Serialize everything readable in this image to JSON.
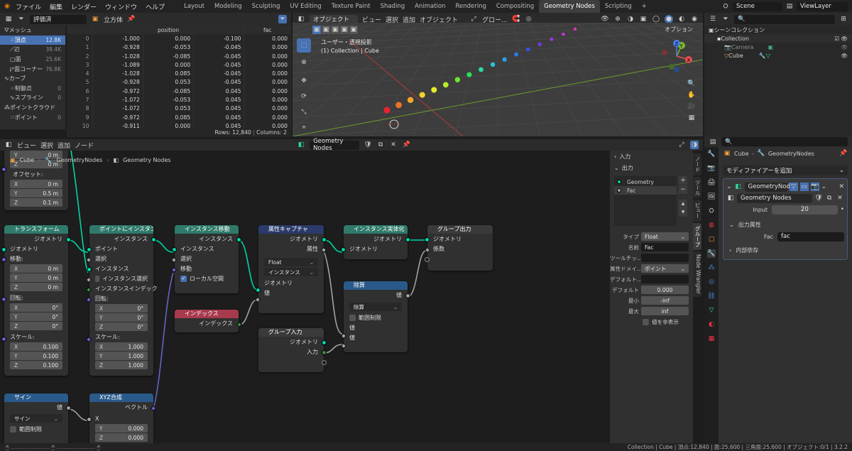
{
  "topbar": {
    "menus": [
      "ファイル",
      "編集",
      "レンダー",
      "ウィンドウ",
      "ヘルプ"
    ],
    "workspaces": [
      "Layout",
      "Modeling",
      "Sculpting",
      "UV Editing",
      "Texture Paint",
      "Shading",
      "Animation",
      "Rendering",
      "Compositing",
      "Geometry Nodes",
      "Scripting"
    ],
    "active_workspace": "Geometry Nodes",
    "scene": "Scene",
    "view_layer": "ViewLayer"
  },
  "spreadsheet": {
    "header_mode": "評価済",
    "object": "立方体",
    "left_items": [
      {
        "label": "メッシュ",
        "count": ""
      },
      {
        "label": "頂点",
        "count": "12.8K"
      },
      {
        "label": "辺",
        "count": "38.4K"
      },
      {
        "label": "面",
        "count": "25.6K"
      },
      {
        "label": "面コーナー",
        "count": "76.8K"
      },
      {
        "label": "カーブ",
        "count": ""
      },
      {
        "label": "制御点",
        "count": "0"
      },
      {
        "label": "スプライン",
        "count": "0"
      },
      {
        "label": "ポイントクラウド",
        "count": ""
      },
      {
        "label": "ポイント",
        "count": "0"
      }
    ],
    "columns": [
      "position",
      "fac"
    ],
    "rows": [
      [
        "0",
        "-1.000",
        "0.000",
        "-0.100",
        "0.000"
      ],
      [
        "1",
        "-0.928",
        "-0.053",
        "-0.045",
        "0.000"
      ],
      [
        "2",
        "-1.028",
        "-0.085",
        "-0.045",
        "0.000"
      ],
      [
        "3",
        "-1.089",
        "0.000",
        "-0.045",
        "0.000"
      ],
      [
        "4",
        "-1.028",
        "0.085",
        "-0.045",
        "0.000"
      ],
      [
        "5",
        "-0.928",
        "0.053",
        "-0.045",
        "0.000"
      ],
      [
        "6",
        "-0.972",
        "-0.085",
        "0.045",
        "0.000"
      ],
      [
        "7",
        "-1.072",
        "-0.053",
        "0.045",
        "0.000"
      ],
      [
        "8",
        "-1.072",
        "0.053",
        "0.045",
        "0.000"
      ],
      [
        "9",
        "-0.972",
        "0.085",
        "0.045",
        "0.000"
      ],
      [
        "10",
        "-0.911",
        "0.000",
        "0.045",
        "0.000"
      ]
    ],
    "footer_rows": "Rows: 12,840",
    "footer_cols": "Columns: 2"
  },
  "viewport": {
    "mode": "オブジェクト",
    "menus": [
      "ビュー",
      "選択",
      "追加",
      "オブジェクト"
    ],
    "global": "グロー...",
    "overlay1": "ユーザー・透視投影",
    "overlay2": "(1) Collection | Cube",
    "options": "オプション",
    "gizmo_x": "X",
    "gizmo_y": "Y",
    "gizmo_z": "Z"
  },
  "outliner": {
    "title": "シーンコレクション",
    "collection": "Collection",
    "camera": "Camera",
    "cube": "Cube"
  },
  "node_editor": {
    "menus": [
      "ビュー",
      "選択",
      "追加",
      "ノード"
    ],
    "tree_name": "Geometry Nodes",
    "breadcrumb": [
      "Cube",
      "GeometryNodes",
      "Geometry Nodes"
    ],
    "partial_top": {
      "y": "0 m",
      "z": "0 m",
      "offset_label": "オフセット:",
      "x_val": "0 m",
      "y_val": "0.5 m",
      "z_val": "0.1 m"
    },
    "transform": {
      "title": "トランスフォーム",
      "geometry_out": "ジオメトリ",
      "geometry_in": "ジオメトリ",
      "translation": "移動:",
      "rotation": "回転:",
      "scale": "スケール:",
      "t": [
        "0 m",
        "0 m",
        "0 m"
      ],
      "r": [
        "0°",
        "0°",
        "0°"
      ],
      "s": [
        "0.100",
        "0.100",
        "0.100"
      ]
    },
    "instance_on_points": {
      "title": "ポイントにインスタン...",
      "out": "インスタンス",
      "points": "ポイント",
      "selection": "選択",
      "instance": "インスタンス",
      "pick": "インスタンス選択",
      "index": "インスタンスインデック",
      "rotation": "回転:",
      "scale": "スケール:",
      "r": [
        "0°",
        "0°",
        "0°"
      ],
      "s": [
        "1.000",
        "1.000",
        "1.000"
      ]
    },
    "translate_instances": {
      "title": "インスタンス移動",
      "out": "インスタンス",
      "in": "インスタンス",
      "selection": "選択",
      "translation": "移動",
      "local": "ローカル空間"
    },
    "index": {
      "title": "インデックス",
      "out": "インデックス"
    },
    "capture": {
      "title": "属性キャプチャ",
      "geo_out": "ジオメトリ",
      "attr_out": "属性",
      "type": "Float",
      "domain": "インスタンス",
      "geo_in": "ジオメトリ",
      "value": "値"
    },
    "realize": {
      "title": "インスタンス実体化",
      "out": "ジオメトリ",
      "in": "ジオメトリ"
    },
    "group_output": {
      "title": "グループ出力",
      "geo": "ジオメトリ",
      "fac": "係数"
    },
    "divide": {
      "title": "除算",
      "out": "値",
      "op": "除算",
      "clamp": "範囲制限",
      "a": "値",
      "b": "値"
    },
    "group_input": {
      "title": "グループ入力",
      "geo": "ジオメトリ",
      "input": "入力"
    },
    "sine": {
      "title": "サイン",
      "out": "値",
      "op": "サイン",
      "clamp": "範囲制限"
    },
    "combine_xyz": {
      "title": "XYZ合成",
      "out": "ベクトル",
      "x": "X",
      "y_label": "Y",
      "y_val": "0.000",
      "z_label": "Z",
      "z_val": "0.000"
    },
    "labels_x": "X",
    "labels_y": "Y",
    "labels_z": "Z"
  },
  "group_panel": {
    "inputs_label": "入力",
    "outputs_label": "出力",
    "items": [
      "Geometry",
      "Fac"
    ],
    "type_label": "タイプ",
    "type_val": "Float",
    "name_label": "名前",
    "name_val": "Fac",
    "tooltip_label": "ツールチッ...",
    "domain_label": "属性ドメイ...",
    "domain_val": "ポイント",
    "default_label": "デフォルト...",
    "default2_label": "デフォルト",
    "default2_val": "0.000",
    "min_label": "最小",
    "min_val": "-inf",
    "max_label": "最大",
    "max_val": "inf",
    "hide_value": "値を非表示"
  },
  "sidebar_tabs": [
    "ノード",
    "ツール",
    "ビュー",
    "グループ",
    "Node Wrangler"
  ],
  "properties": {
    "breadcrumb": [
      "Cube",
      "GeometryNodes"
    ],
    "add_modifier": "モディファイアーを追加",
    "modifier_name": "GeometryNod...",
    "tree": "Geometry Nodes",
    "input_label": "Input",
    "input_val": "20",
    "output_attr": "出力属性",
    "fac_label": "Fac",
    "fac_val": "fac",
    "internal": "内部依存"
  },
  "status": "Collection | Cube | 頂点:12,840 | 面:25,600 | 三角面:25,600 | オブジェクト:0/1 | 3.2.2",
  "dot_colors": [
    "#e8232e",
    "#e8732a",
    "#f0a62a",
    "#f2d12a",
    "#e4ec2a",
    "#b8ec2a",
    "#6ee62a",
    "#2ae05a",
    "#2ad9a0",
    "#2ac4d8",
    "#2a9ee8",
    "#2a78ee",
    "#3a52ee",
    "#6a3aee",
    "#9a34e4",
    "#c634d8",
    "#e034c0"
  ]
}
